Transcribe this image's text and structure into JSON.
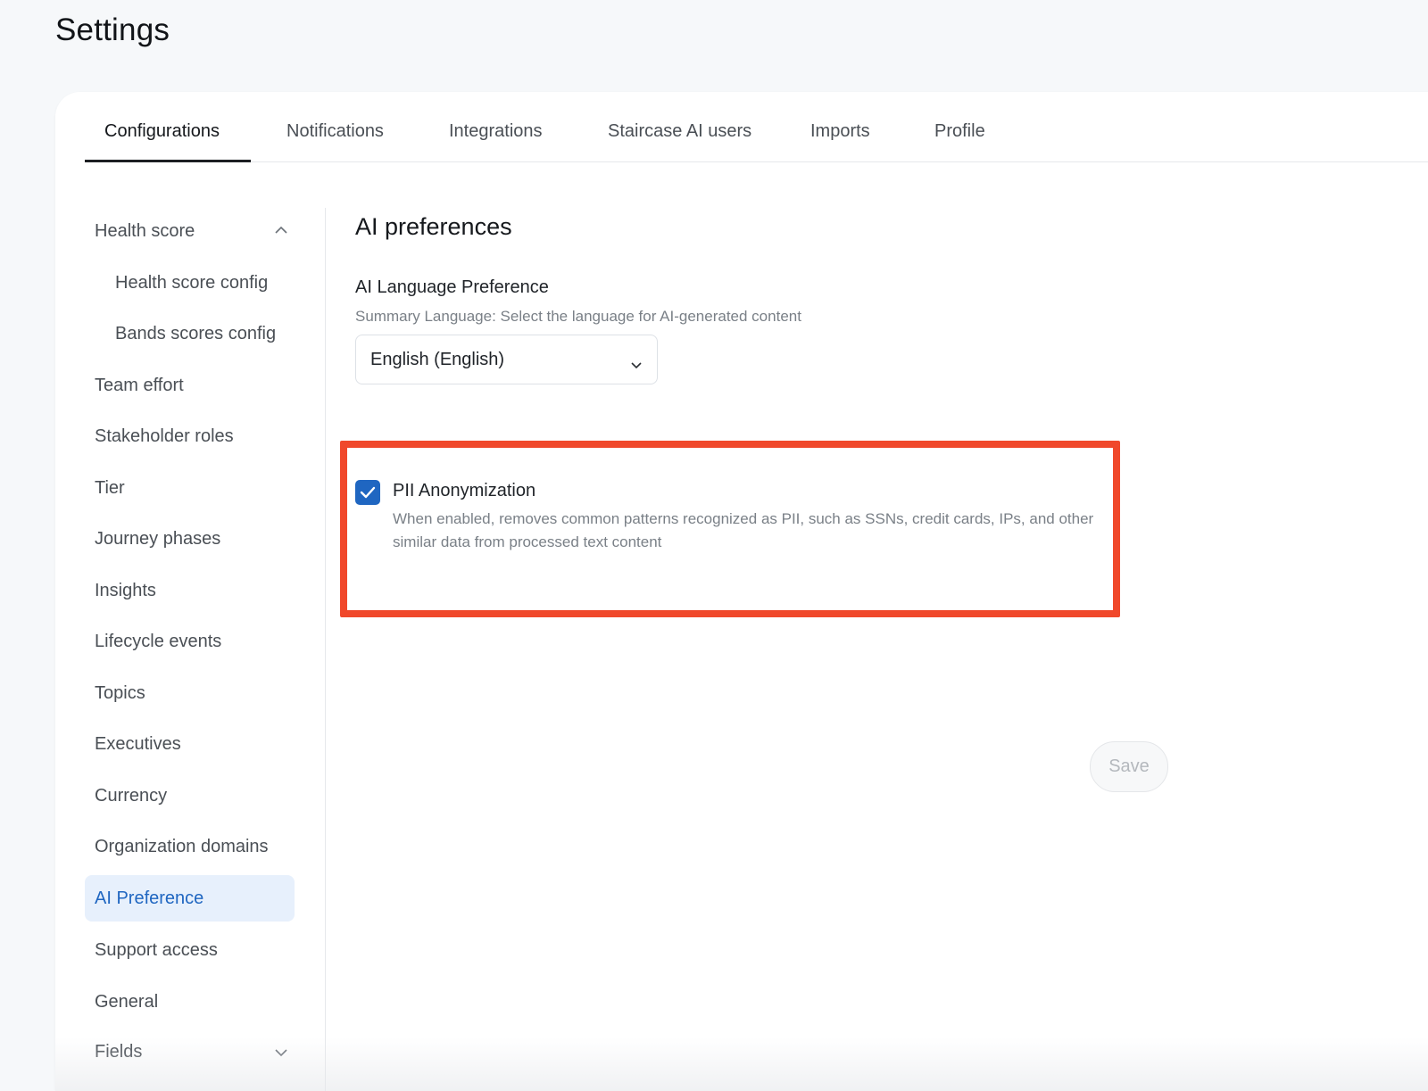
{
  "page": {
    "title": "Settings"
  },
  "tabs": [
    {
      "label": "Configurations",
      "active": true
    },
    {
      "label": "Notifications"
    },
    {
      "label": "Integrations"
    },
    {
      "label": "Staircase AI users"
    },
    {
      "label": "Imports"
    },
    {
      "label": "Profile"
    }
  ],
  "sidebar": {
    "items": [
      {
        "label": "Health score",
        "expanded": true,
        "icon": "chevron-up-icon"
      },
      {
        "label": "Health score config",
        "sub": true
      },
      {
        "label": "Bands scores config",
        "sub": true
      },
      {
        "label": "Team effort"
      },
      {
        "label": "Stakeholder roles"
      },
      {
        "label": "Tier"
      },
      {
        "label": "Journey phases"
      },
      {
        "label": "Insights"
      },
      {
        "label": "Lifecycle events"
      },
      {
        "label": "Topics"
      },
      {
        "label": "Executives"
      },
      {
        "label": "Currency"
      },
      {
        "label": "Organization domains"
      },
      {
        "label": "AI Preference",
        "active": true
      },
      {
        "label": "Support access"
      },
      {
        "label": "General"
      },
      {
        "label": "Fields",
        "expanded": false,
        "icon": "chevron-down-icon"
      }
    ]
  },
  "content": {
    "section_title": "AI preferences",
    "language": {
      "label": "AI Language Preference",
      "help": "Summary Language: Select the language for AI-generated content",
      "selected": "English (English)"
    },
    "pii": {
      "checked": true,
      "label": "PII Anonymization",
      "description": "When enabled, removes common patterns recognized as PII, such as SSNs, credit cards, IPs, and other similar data from processed text content"
    },
    "save_label": "Save"
  },
  "colors": {
    "accent": "#1f66c1",
    "highlight_border": "#f0482b",
    "active_item_bg": "#e7f0fc"
  }
}
